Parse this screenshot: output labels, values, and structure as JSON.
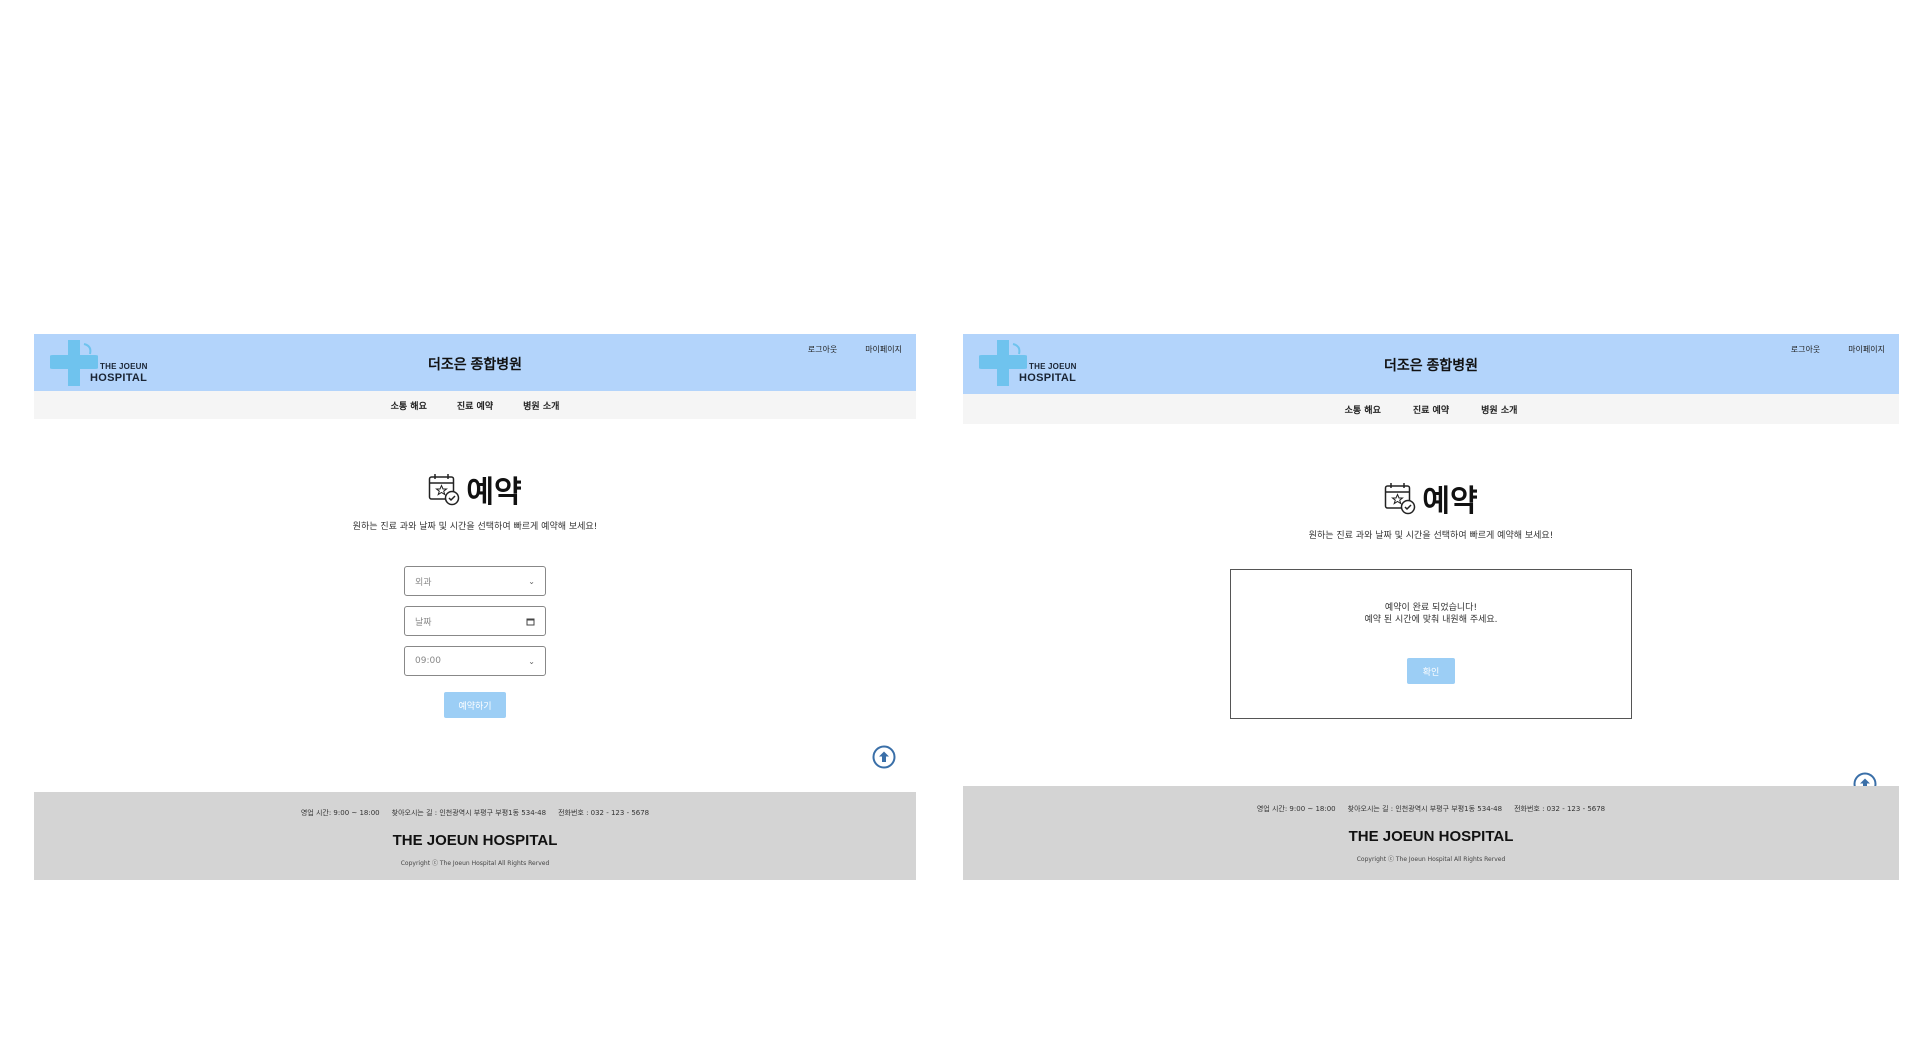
{
  "left": {
    "header": {
      "logo_line1": "THE JOEUN",
      "logo_line2": "HOSPITAL",
      "title": "더조은 종합병원",
      "logout": "로그아웃",
      "mypage": "마이페이지"
    },
    "nav": {
      "item1": "소통 해요",
      "item2": "진료 예약",
      "item3": "병원 소개"
    },
    "main": {
      "heading": "예약",
      "subtitle": "원하는 진료 과와 날짜 및 시간을 선택하여 빠르게 예약해 보세요!"
    },
    "form": {
      "department": "외과",
      "date": "날짜",
      "time": "09:00",
      "submit": "예약하기"
    },
    "footer": {
      "hours": "영업 시간: 9:00 ~ 18:00",
      "address": "찾아오시는 길 : 인천광역시 부평구 부평1동 534-48",
      "phone": "전화번호 : 032 - 123 - 5678",
      "brand": "THE JOEUN HOSPITAL",
      "copyright": "Copyright ⓒ The Joeun Hospital All Rights Rerved"
    }
  },
  "right": {
    "header": {
      "logo_line1": "THE JOEUN",
      "logo_line2": "HOSPITAL",
      "title": "더조은 종합병원",
      "logout": "로그아웃",
      "mypage": "마이페이지"
    },
    "nav": {
      "item1": "소통 해요",
      "item2": "진료 예약",
      "item3": "병원 소개"
    },
    "main": {
      "heading": "예약",
      "subtitle": "원하는 진료 과와 날짜 및 시간을 선택하여 빠르게 예약해 보세요!"
    },
    "modal": {
      "line1": "예약이 완료 되었습니다!",
      "line2": "예약 된 시간에 맞춰 내원해 주세요.",
      "confirm": "확인"
    },
    "footer": {
      "hours": "영업 시간: 9:00 ~ 18:00",
      "address": "찾아오시는 길 : 인천광역시 부평구 부평1동 534-48",
      "phone": "전화번호 : 032 - 123 - 5678",
      "brand": "THE JOEUN HOSPITAL",
      "copyright": "Copyright ⓒ The Joeun Hospital All Rights Rerved"
    }
  },
  "colors": {
    "header_bg": "#b3d4fb",
    "nav_bg": "#f5f5f5",
    "footer_bg": "#d4d4d4",
    "button_bg": "#9ccef5",
    "logo_cross": "#6fc3ee",
    "scroll_icon": "#3a6fa8"
  },
  "icons": {
    "logo": "medical-cross-logo",
    "heading": "calendar-check-icon",
    "scroll_top": "arrow-up-circle-icon",
    "date": "calendar-icon",
    "select": "chevron-down-icon"
  }
}
